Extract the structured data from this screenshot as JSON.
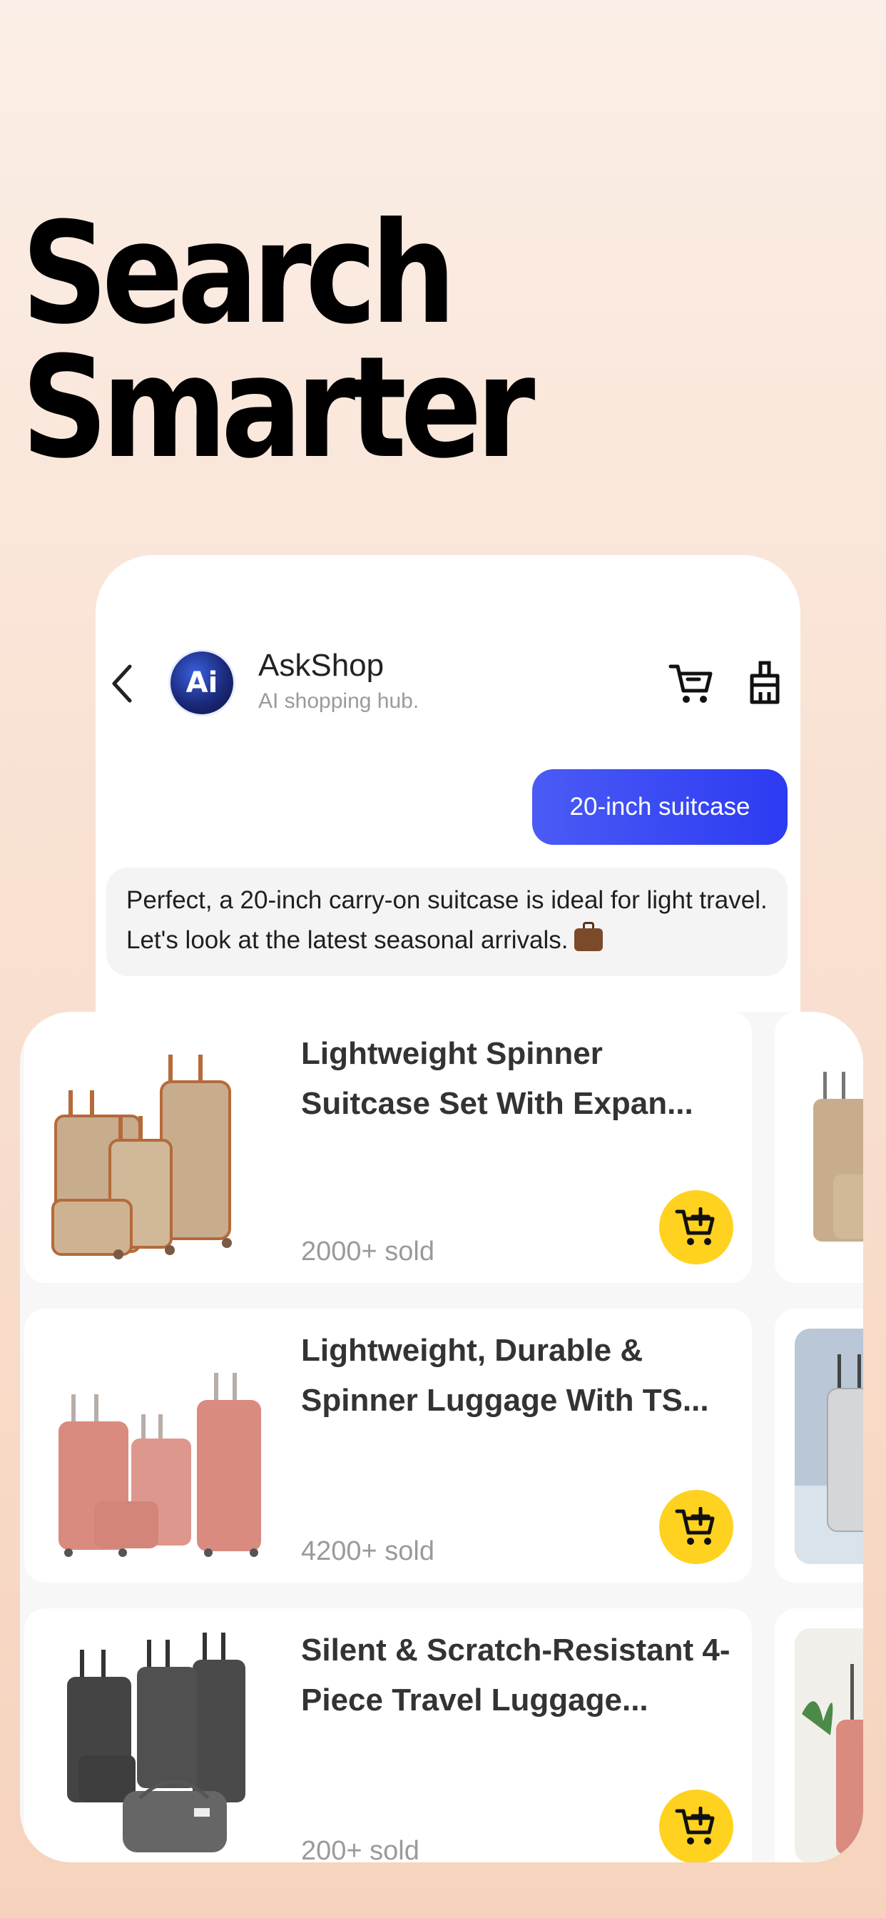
{
  "headline": {
    "line1": "Search",
    "line2": "Smarter"
  },
  "header": {
    "app_name": "AskShop",
    "subtitle": "AI shopping hub.",
    "avatar_text": "Ai"
  },
  "chat": {
    "user_message": "20-inch suitcase",
    "bot_message": "Perfect, a 20-inch carry-on suitcase is ideal for light travel. Let's look at the latest seasonal arrivals."
  },
  "products": [
    {
      "title": "Lightweight Spinner Suitcase Set With Expan...",
      "sold": "2000+ sold",
      "color": "#c7ad8e",
      "trim": "#b56a3a"
    },
    {
      "title": "Lightweight, Durable & Spinner Luggage With TS...",
      "sold": "4200+ sold",
      "color": "#d98b80",
      "trim": "#c57a70"
    },
    {
      "title": "Silent & Scratch-Resistant 4-Piece Travel Luggage...",
      "sold": "200+ sold",
      "color": "#4a4a4a",
      "trim": "#333333"
    }
  ],
  "colors": {
    "accent_blue": "#3a48f3",
    "cart_yellow": "#ffd21f"
  },
  "icons": [
    "back-icon",
    "cart-icon",
    "clean-icon",
    "add-to-cart-icon"
  ]
}
